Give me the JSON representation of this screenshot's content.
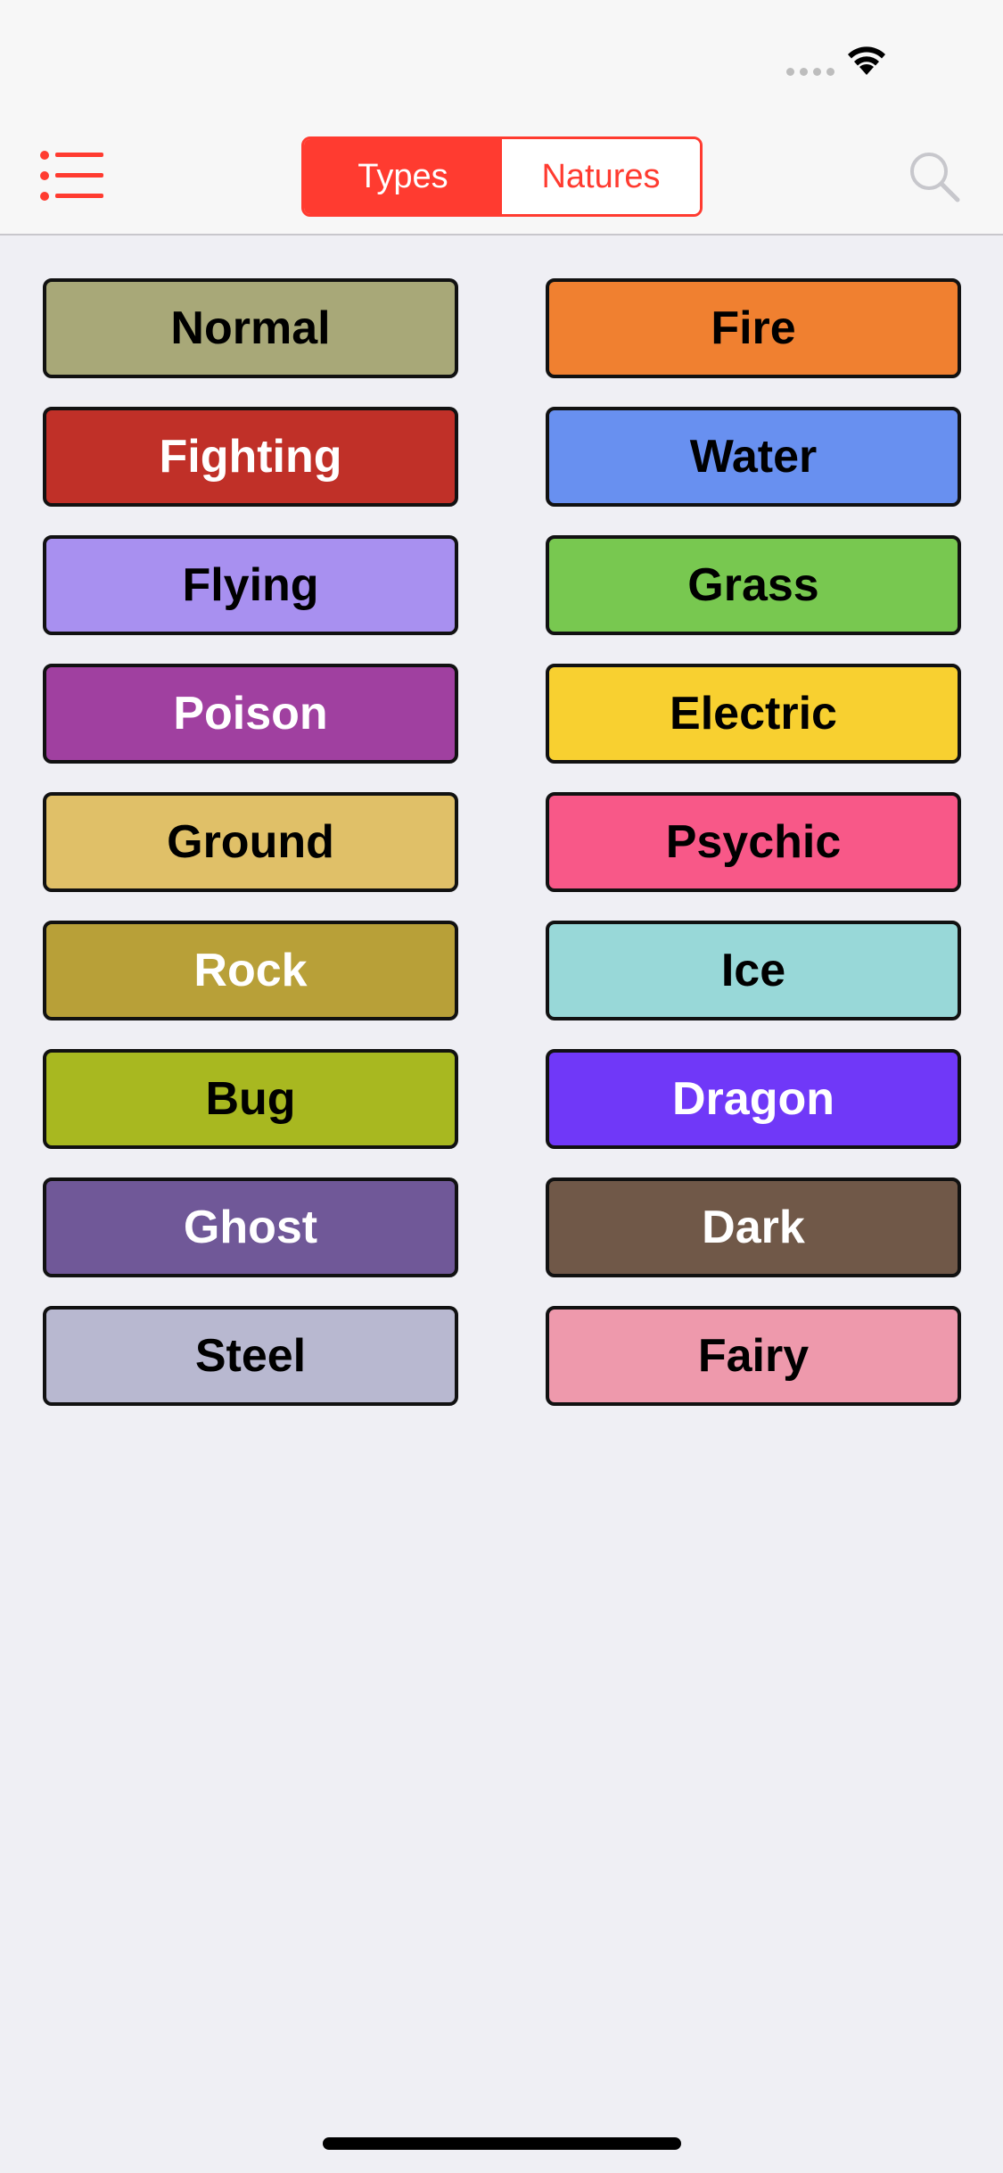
{
  "nav": {
    "segments": [
      {
        "label": "Types",
        "selected": true
      },
      {
        "label": "Natures",
        "selected": false
      }
    ],
    "menu_icon": "list-icon",
    "search_icon": "search-icon",
    "accent_color": "#ff3b30"
  },
  "types": [
    {
      "name": "Normal",
      "bg": "#a8a878",
      "fg": "#000000"
    },
    {
      "name": "Fire",
      "bg": "#f08030",
      "fg": "#000000"
    },
    {
      "name": "Fighting",
      "bg": "#c03028",
      "fg": "#ffffff"
    },
    {
      "name": "Water",
      "bg": "#6890f0",
      "fg": "#000000"
    },
    {
      "name": "Flying",
      "bg": "#a890f0",
      "fg": "#000000"
    },
    {
      "name": "Grass",
      "bg": "#78c850",
      "fg": "#000000"
    },
    {
      "name": "Poison",
      "bg": "#a040a0",
      "fg": "#ffffff"
    },
    {
      "name": "Electric",
      "bg": "#f8d030",
      "fg": "#000000"
    },
    {
      "name": "Ground",
      "bg": "#e0c068",
      "fg": "#000000"
    },
    {
      "name": "Psychic",
      "bg": "#f85888",
      "fg": "#000000"
    },
    {
      "name": "Rock",
      "bg": "#b8a038",
      "fg": "#ffffff"
    },
    {
      "name": "Ice",
      "bg": "#98d8d8",
      "fg": "#000000"
    },
    {
      "name": "Bug",
      "bg": "#a8b820",
      "fg": "#000000"
    },
    {
      "name": "Dragon",
      "bg": "#7038f8",
      "fg": "#ffffff"
    },
    {
      "name": "Ghost",
      "bg": "#705898",
      "fg": "#ffffff"
    },
    {
      "name": "Dark",
      "bg": "#705848",
      "fg": "#ffffff"
    },
    {
      "name": "Steel",
      "bg": "#b8b8d0",
      "fg": "#000000"
    },
    {
      "name": "Fairy",
      "bg": "#ee99ac",
      "fg": "#000000"
    }
  ]
}
